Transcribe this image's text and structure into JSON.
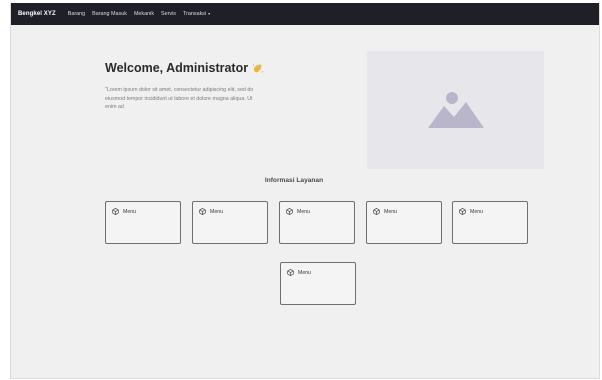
{
  "navbar": {
    "brand": "Bengkel XYZ",
    "links": [
      "Barang",
      "Barang Masuk",
      "Mekanik",
      "Servis",
      "Transaksi"
    ],
    "dropdown_caret": "▾"
  },
  "hero": {
    "title": "Welcome, Administrator",
    "title_icon": "waving-hand-icon",
    "text": "\"Lorem ipsum dolor sit amet, consectetur adipiscing elit, sed do eiusmod tempor incididunt ut labore et dolore magna aliqua. Ut enim ad",
    "image_icon": "image-placeholder-icon"
  },
  "services": {
    "title": "Informasi Layanan",
    "cards": [
      {
        "label": "Menu",
        "icon": "cube-icon"
      },
      {
        "label": "Menu",
        "icon": "cube-icon"
      },
      {
        "label": "Menu",
        "icon": "cube-icon"
      },
      {
        "label": "Menu",
        "icon": "cube-icon"
      },
      {
        "label": "Menu",
        "icon": "cube-icon"
      },
      {
        "label": "Menu",
        "icon": "cube-icon"
      }
    ]
  },
  "colors": {
    "navbar_bg": "#1f2027",
    "page_bg": "#f0f0f0",
    "placeholder_bg": "#e7e7eb",
    "placeholder_icon": "#b9b6cb",
    "wave_icon": "#f2b233"
  }
}
